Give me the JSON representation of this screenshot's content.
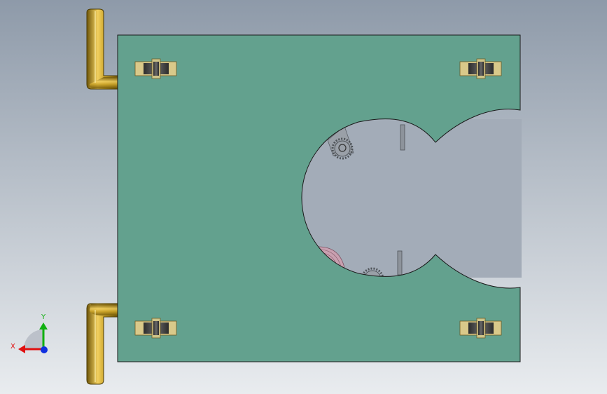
{
  "viewport": {
    "background_top": "#8e9aa9",
    "background_bottom": "#e9ecef"
  },
  "part": {
    "name": "plate",
    "color": "#63a18e",
    "edge_color": "#1a1a1a"
  },
  "handles": {
    "color": "#c9a227",
    "shade": "#7a5e10",
    "count": 2
  },
  "wheels": {
    "count": 4,
    "rim_color": "#d9c98a",
    "tire_color": "#4a4a4a"
  },
  "internal_parts": {
    "gear_color": "#6a6f75",
    "bracket_color": "#9aa0a8",
    "pink_part_color": "#c9a0b0"
  },
  "triad": {
    "x_label": "X",
    "y_label": "Y",
    "x_color": "#e01010",
    "y_color": "#10b010",
    "z_color": "#1030e0"
  }
}
